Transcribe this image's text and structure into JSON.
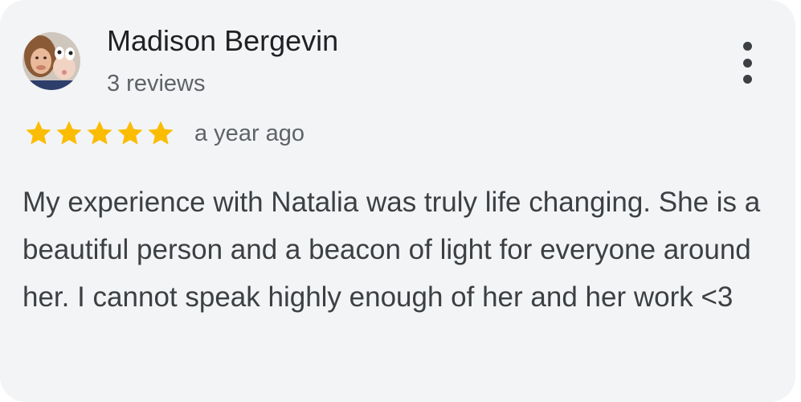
{
  "review": {
    "author": "Madison Bergevin",
    "review_count": "3 reviews",
    "rating": 5,
    "rating_max": 5,
    "time_ago": "a year ago",
    "text": "My experience with Natalia was truly life changing. She is a beautiful person and a beacon of light for everyone around her. I cannot speak highly enough of her and her work <3"
  },
  "colors": {
    "star": "#fbbc04",
    "card_background": "#f3f4f6",
    "name_text": "#202124",
    "secondary_text": "#5f6368"
  },
  "icons": {
    "menu": "more-vert-icon",
    "star": "star-filled-icon"
  }
}
